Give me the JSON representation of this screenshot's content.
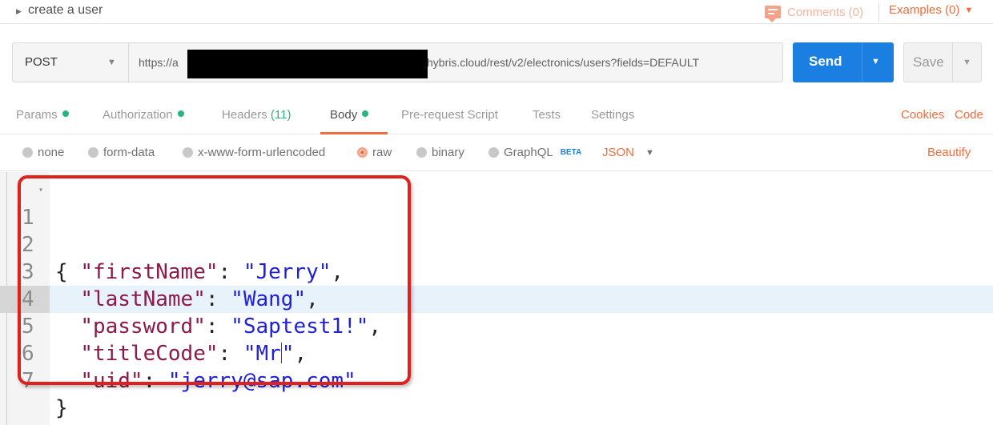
{
  "title_bar": {
    "request_name": "create a user",
    "comments_label": "Comments (0)",
    "examples_label": "Examples (0)"
  },
  "request": {
    "method": "POST",
    "url_prefix": "https://a",
    "url_suffix": "hybris.cloud/rest/v2/electronics/users?fields=DEFAULT",
    "send_label": "Send",
    "save_label": "Save"
  },
  "tabs": [
    {
      "label": "Params",
      "indicator": true
    },
    {
      "label": "Authorization",
      "indicator": true
    },
    {
      "label": "Headers",
      "count": "(11)"
    },
    {
      "label": "Body",
      "indicator": true,
      "active": true
    },
    {
      "label": "Pre-request Script"
    },
    {
      "label": "Tests"
    },
    {
      "label": "Settings"
    }
  ],
  "tab_links": {
    "cookies": "Cookies",
    "code": "Code"
  },
  "body_types": {
    "options": [
      "none",
      "form-data",
      "x-www-form-urlencoded",
      "raw",
      "binary",
      "GraphQL"
    ],
    "selected": "raw",
    "graphql_badge": "BETA",
    "format": "JSON",
    "beautify": "Beautify"
  },
  "editor": {
    "active_line": 5,
    "lines": [
      {
        "n": "1",
        "open": "{"
      },
      {
        "n": "2",
        "key": "\"firstName\"",
        "value": "\"Jerry\"",
        "trail": ","
      },
      {
        "n": "3",
        "key": "\"lastName\"",
        "value": "\"Wang\"",
        "trail": ","
      },
      {
        "n": "4",
        "key": "\"password\"",
        "value": "\"Saptest1!\"",
        "trail": ","
      },
      {
        "n": "5",
        "key": "\"titleCode\"",
        "value_a": "\"Mr",
        "value_b": "\"",
        "trail": ","
      },
      {
        "n": "6",
        "key": "\"uid\"",
        "value": "\"jerry@sap.com\""
      },
      {
        "n": "7",
        "close": "}"
      }
    ]
  },
  "colors": {
    "accent": "#f26b3a",
    "send_blue": "#1a7fe0",
    "status_green": "#26b47f",
    "json_key": "#8b1a4a",
    "json_string": "#2020d6",
    "annotation_red": "#e0201c"
  }
}
